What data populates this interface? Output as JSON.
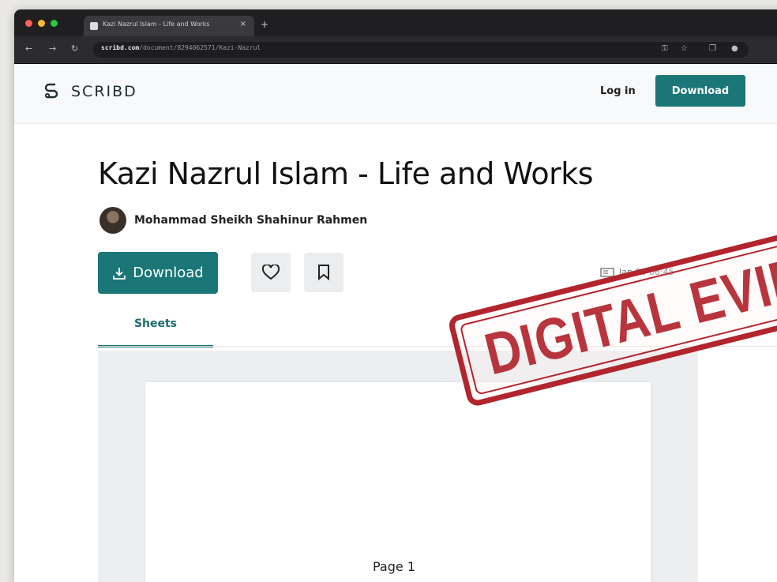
{
  "browser": {
    "tab_title": "Kazi Nazrul Islam - Life and Works",
    "tab_close": "×",
    "new_tab": "+",
    "url_domain": "scribd.com",
    "url_path": "/document/8294062571/Kazi-Nazrul"
  },
  "site": {
    "logo_text": "SCRIBD",
    "login_label": "Log in",
    "header_download_label": "Download"
  },
  "document": {
    "title": "Kazi Nazrul Islam - Life and Works",
    "author": "Mohammad Sheikh Shahinur Rahmen",
    "download_label": "Download",
    "meta_text": "Jan 06 06:45",
    "tab_label": "Sheets",
    "page_label": "Page 1"
  },
  "stamp": {
    "text": "DIGITAL EVIDENC"
  },
  "colors": {
    "accent": "#1a7677",
    "stamp_red": "#b2252d"
  }
}
